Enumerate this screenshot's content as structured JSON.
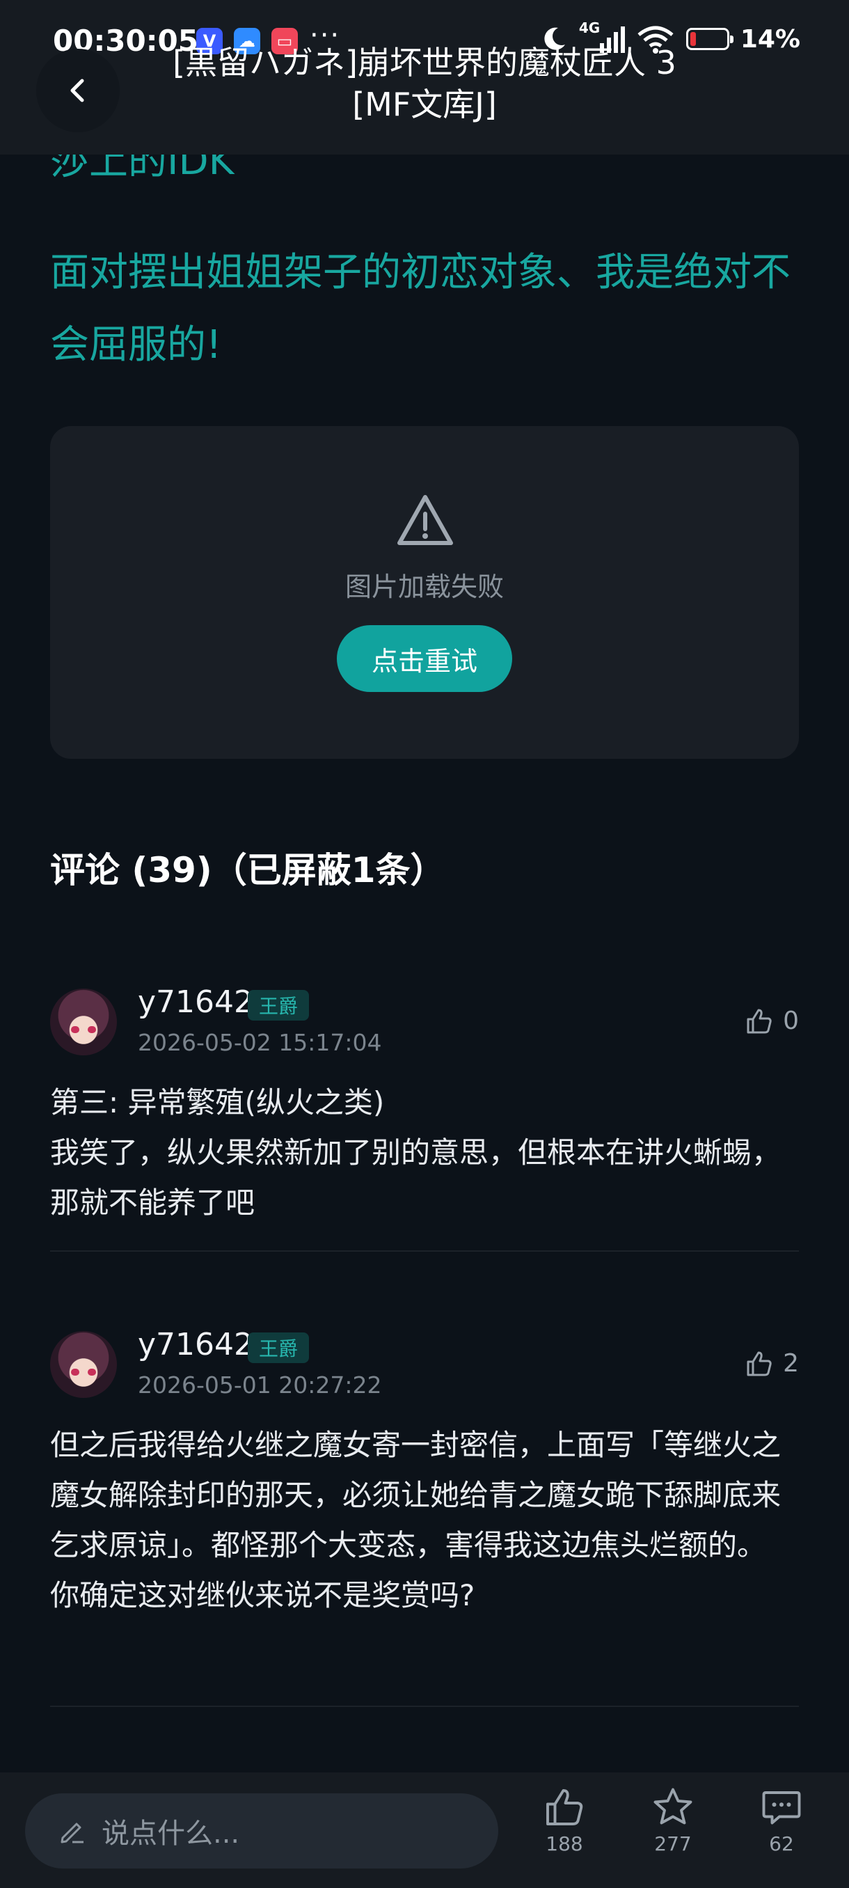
{
  "status_bar": {
    "time": "00:30:05",
    "network": "4G",
    "battery": "14%",
    "apps": [
      {
        "name": "v-app-icon",
        "glyph": "V",
        "color": "#3b5bff"
      },
      {
        "name": "cloud-app-icon",
        "glyph": "☁",
        "color": "#2f8bff"
      },
      {
        "name": "store-app-icon",
        "glyph": "▭",
        "color": "#f0465a"
      }
    ],
    "more": "···"
  },
  "header": {
    "title": "[黒留ハガネ]崩坏世界的魔杖匠人 3 [MF文库J]"
  },
  "article": {
    "cut_line": "莎上的IDK",
    "chapter_title": "面对摆出姐姐架子的初恋对象、我是绝对不会屈服的!"
  },
  "image_error": {
    "message": "图片加载失败",
    "retry_label": "点击重试"
  },
  "comments": {
    "heading": "评论 (39)（已屏蔽1条）",
    "items": [
      {
        "user": "y71642",
        "badge": "王爵",
        "time": "2026-05-02 15:17:04",
        "likes": "0",
        "text": "第三: 异常繁殖(纵火之类)\n我笑了，纵火果然新加了别的意思，但根本在讲火蜥蜴，那就不能养了吧"
      },
      {
        "user": "y71642",
        "badge": "王爵",
        "time": "2026-05-01 20:27:22",
        "likes": "2",
        "text": "但之后我得给火继之魔女寄一封密信，上面写「等继火之魔女解除封印的那天，必须让她给青之魔女跪下舔脚底来乞求原谅」。都怪那个大变态，害得我这边焦头烂额的。\n你确定这对继伙来说不是奖赏吗?"
      }
    ]
  },
  "bottom_bar": {
    "input_placeholder": "说点什么...",
    "like_count": "188",
    "favorite_count": "277",
    "comment_count": "62"
  },
  "colors": {
    "accent": "#11a39e",
    "chapter_text": "#18a7a0",
    "background": "#0c1219",
    "card": "#191e25"
  }
}
